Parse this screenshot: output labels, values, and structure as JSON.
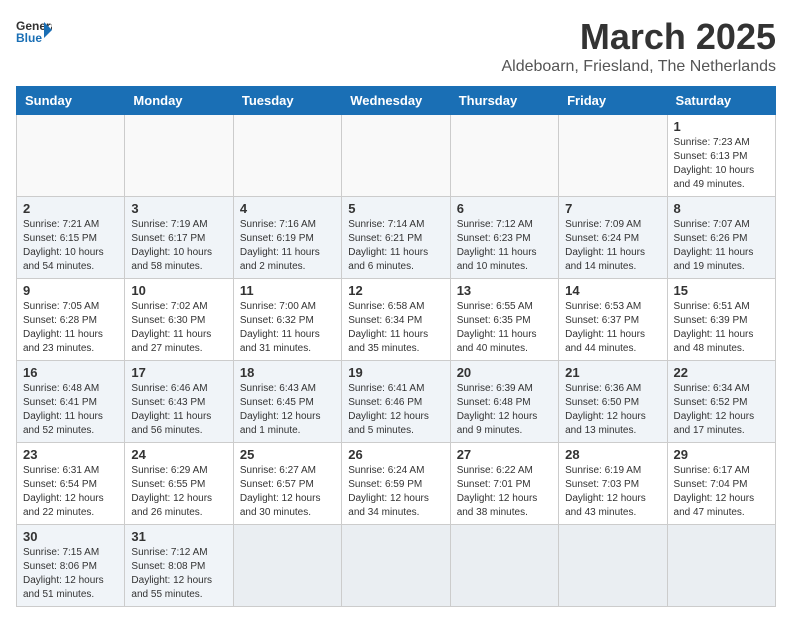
{
  "logo": {
    "text_general": "General",
    "text_blue": "Blue"
  },
  "header": {
    "month": "March 2025",
    "location": "Aldeboarn, Friesland, The Netherlands"
  },
  "weekdays": [
    "Sunday",
    "Monday",
    "Tuesday",
    "Wednesday",
    "Thursday",
    "Friday",
    "Saturday"
  ],
  "weeks": [
    [
      {
        "day": "",
        "detail": ""
      },
      {
        "day": "",
        "detail": ""
      },
      {
        "day": "",
        "detail": ""
      },
      {
        "day": "",
        "detail": ""
      },
      {
        "day": "",
        "detail": ""
      },
      {
        "day": "",
        "detail": ""
      },
      {
        "day": "1",
        "detail": "Sunrise: 7:23 AM\nSunset: 6:13 PM\nDaylight: 10 hours\nand 49 minutes."
      }
    ],
    [
      {
        "day": "2",
        "detail": "Sunrise: 7:21 AM\nSunset: 6:15 PM\nDaylight: 10 hours\nand 54 minutes."
      },
      {
        "day": "3",
        "detail": "Sunrise: 7:19 AM\nSunset: 6:17 PM\nDaylight: 10 hours\nand 58 minutes."
      },
      {
        "day": "4",
        "detail": "Sunrise: 7:16 AM\nSunset: 6:19 PM\nDaylight: 11 hours\nand 2 minutes."
      },
      {
        "day": "5",
        "detail": "Sunrise: 7:14 AM\nSunset: 6:21 PM\nDaylight: 11 hours\nand 6 minutes."
      },
      {
        "day": "6",
        "detail": "Sunrise: 7:12 AM\nSunset: 6:23 PM\nDaylight: 11 hours\nand 10 minutes."
      },
      {
        "day": "7",
        "detail": "Sunrise: 7:09 AM\nSunset: 6:24 PM\nDaylight: 11 hours\nand 14 minutes."
      },
      {
        "day": "8",
        "detail": "Sunrise: 7:07 AM\nSunset: 6:26 PM\nDaylight: 11 hours\nand 19 minutes."
      }
    ],
    [
      {
        "day": "9",
        "detail": "Sunrise: 7:05 AM\nSunset: 6:28 PM\nDaylight: 11 hours\nand 23 minutes."
      },
      {
        "day": "10",
        "detail": "Sunrise: 7:02 AM\nSunset: 6:30 PM\nDaylight: 11 hours\nand 27 minutes."
      },
      {
        "day": "11",
        "detail": "Sunrise: 7:00 AM\nSunset: 6:32 PM\nDaylight: 11 hours\nand 31 minutes."
      },
      {
        "day": "12",
        "detail": "Sunrise: 6:58 AM\nSunset: 6:34 PM\nDaylight: 11 hours\nand 35 minutes."
      },
      {
        "day": "13",
        "detail": "Sunrise: 6:55 AM\nSunset: 6:35 PM\nDaylight: 11 hours\nand 40 minutes."
      },
      {
        "day": "14",
        "detail": "Sunrise: 6:53 AM\nSunset: 6:37 PM\nDaylight: 11 hours\nand 44 minutes."
      },
      {
        "day": "15",
        "detail": "Sunrise: 6:51 AM\nSunset: 6:39 PM\nDaylight: 11 hours\nand 48 minutes."
      }
    ],
    [
      {
        "day": "16",
        "detail": "Sunrise: 6:48 AM\nSunset: 6:41 PM\nDaylight: 11 hours\nand 52 minutes."
      },
      {
        "day": "17",
        "detail": "Sunrise: 6:46 AM\nSunset: 6:43 PM\nDaylight: 11 hours\nand 56 minutes."
      },
      {
        "day": "18",
        "detail": "Sunrise: 6:43 AM\nSunset: 6:45 PM\nDaylight: 12 hours\nand 1 minute."
      },
      {
        "day": "19",
        "detail": "Sunrise: 6:41 AM\nSunset: 6:46 PM\nDaylight: 12 hours\nand 5 minutes."
      },
      {
        "day": "20",
        "detail": "Sunrise: 6:39 AM\nSunset: 6:48 PM\nDaylight: 12 hours\nand 9 minutes."
      },
      {
        "day": "21",
        "detail": "Sunrise: 6:36 AM\nSunset: 6:50 PM\nDaylight: 12 hours\nand 13 minutes."
      },
      {
        "day": "22",
        "detail": "Sunrise: 6:34 AM\nSunset: 6:52 PM\nDaylight: 12 hours\nand 17 minutes."
      }
    ],
    [
      {
        "day": "23",
        "detail": "Sunrise: 6:31 AM\nSunset: 6:54 PM\nDaylight: 12 hours\nand 22 minutes."
      },
      {
        "day": "24",
        "detail": "Sunrise: 6:29 AM\nSunset: 6:55 PM\nDaylight: 12 hours\nand 26 minutes."
      },
      {
        "day": "25",
        "detail": "Sunrise: 6:27 AM\nSunset: 6:57 PM\nDaylight: 12 hours\nand 30 minutes."
      },
      {
        "day": "26",
        "detail": "Sunrise: 6:24 AM\nSunset: 6:59 PM\nDaylight: 12 hours\nand 34 minutes."
      },
      {
        "day": "27",
        "detail": "Sunrise: 6:22 AM\nSunset: 7:01 PM\nDaylight: 12 hours\nand 38 minutes."
      },
      {
        "day": "28",
        "detail": "Sunrise: 6:19 AM\nSunset: 7:03 PM\nDaylight: 12 hours\nand 43 minutes."
      },
      {
        "day": "29",
        "detail": "Sunrise: 6:17 AM\nSunset: 7:04 PM\nDaylight: 12 hours\nand 47 minutes."
      }
    ],
    [
      {
        "day": "30",
        "detail": "Sunrise: 7:15 AM\nSunset: 8:06 PM\nDaylight: 12 hours\nand 51 minutes."
      },
      {
        "day": "31",
        "detail": "Sunrise: 7:12 AM\nSunset: 8:08 PM\nDaylight: 12 hours\nand 55 minutes."
      },
      {
        "day": "",
        "detail": ""
      },
      {
        "day": "",
        "detail": ""
      },
      {
        "day": "",
        "detail": ""
      },
      {
        "day": "",
        "detail": ""
      },
      {
        "day": "",
        "detail": ""
      }
    ]
  ]
}
